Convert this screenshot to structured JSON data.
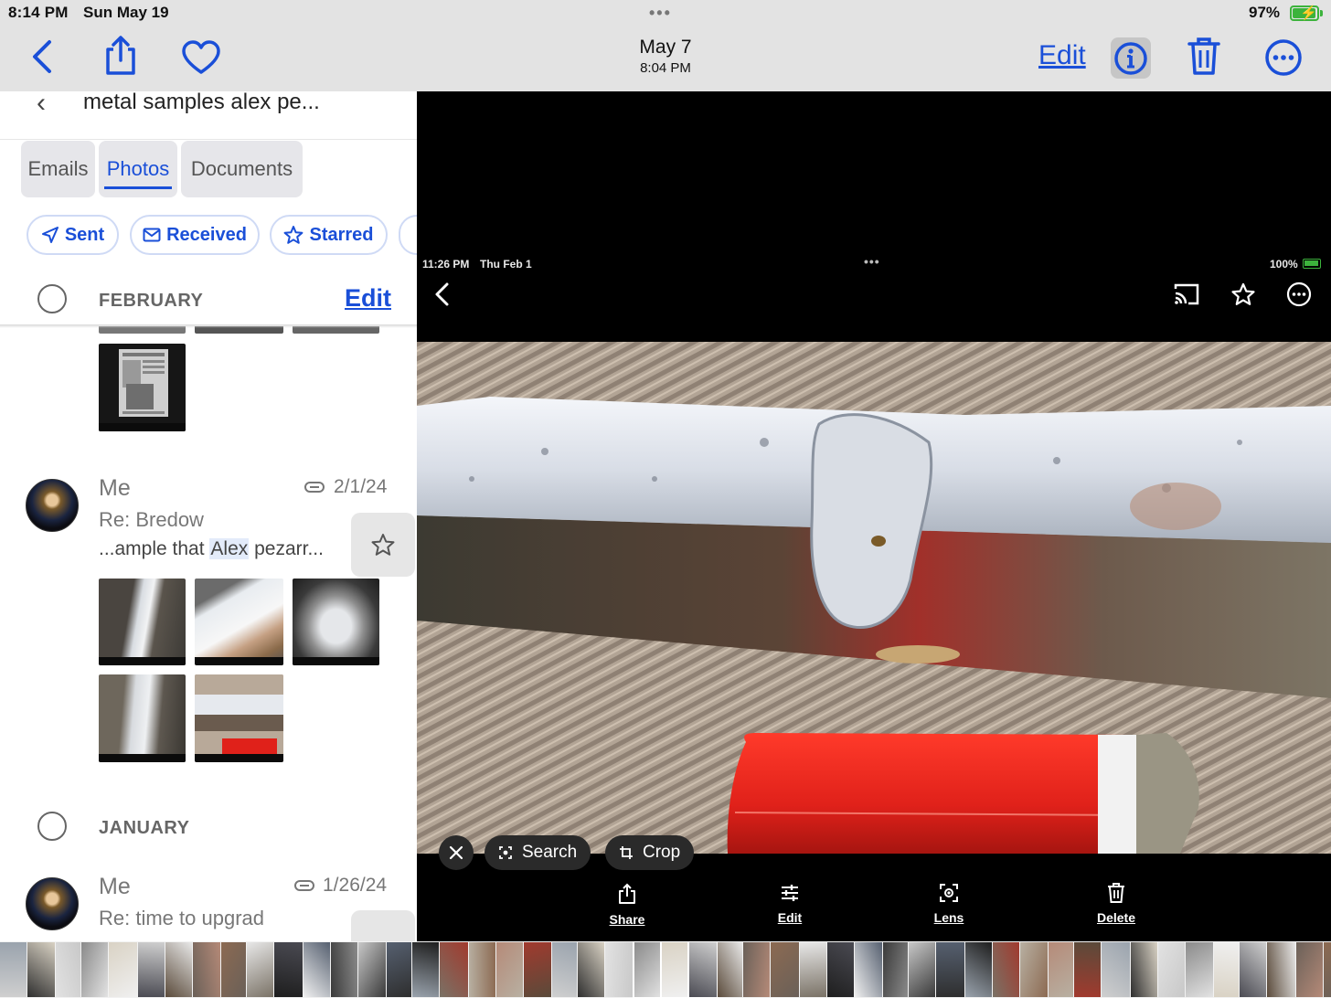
{
  "status_bar": {
    "time": "8:14 PM",
    "date": "Sun May 19",
    "dots": "•••",
    "battery": "97%",
    "battery_level": 0.97
  },
  "photos_nav": {
    "title": "May 7",
    "subtitle": "8:04 PM",
    "edit_label": "Edit",
    "icons": [
      "back-chevron-icon",
      "share-icon",
      "heart-icon",
      "info-icon",
      "trash-icon",
      "more-icon"
    ]
  },
  "mail": {
    "search_query": "metal samples alex pe...",
    "tabs": [
      {
        "label": "Emails",
        "active": false
      },
      {
        "label": "Photos",
        "active": true
      },
      {
        "label": "Documents",
        "active": false
      }
    ],
    "filters": [
      {
        "label": "Sent",
        "icon": "send-icon"
      },
      {
        "label": "Received",
        "icon": "envelope-icon"
      },
      {
        "label": "Starred",
        "icon": "star-icon"
      }
    ],
    "sections": [
      {
        "month": "FEBRUARY",
        "edit_label": "Edit"
      },
      {
        "month": "JANUARY"
      }
    ],
    "messages": [
      {
        "sender": "Me",
        "date": "2/1/24",
        "subject": "Re: Bredow",
        "snippet_before": "...ample that ",
        "snippet_highlight": "Alex",
        "snippet_after": " pezarr...",
        "has_attachment": true,
        "thumbnail_count": 5
      },
      {
        "sender": "Me",
        "date": "1/26/24",
        "subject": "Re: time to upgrad",
        "has_attachment": true
      }
    ]
  },
  "viewer": {
    "inner_status": {
      "time": "11:26 PM",
      "date": "Thu Feb 1",
      "dots": "•••",
      "battery": "100%"
    },
    "pills": [
      {
        "label": "Search",
        "icon": "lens-search-icon"
      },
      {
        "label": "Crop",
        "icon": "crop-icon"
      }
    ],
    "actions": [
      {
        "label": "Share",
        "icon": "share-icon"
      },
      {
        "label": "Edit",
        "icon": "sliders-icon"
      },
      {
        "label": "Lens",
        "icon": "lens-icon"
      },
      {
        "label": "Delete",
        "icon": "trash-icon"
      }
    ]
  },
  "colors": {
    "accent": "#1a4fd8",
    "battery_green": "#3cb33c",
    "lighter_red": "#e0211a"
  }
}
